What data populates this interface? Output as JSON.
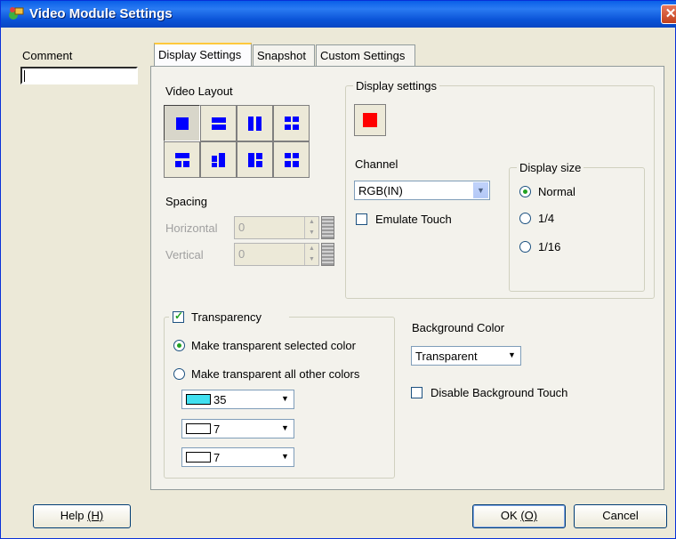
{
  "window": {
    "title": "Video Module Settings",
    "close_glyph": "✕"
  },
  "comment": {
    "label": "Comment",
    "value": ""
  },
  "tabs": [
    {
      "label": "Display Settings"
    },
    {
      "label": "Snapshot"
    },
    {
      "label": "Custom Settings"
    }
  ],
  "video_layout": {
    "label": "Video Layout",
    "buttons": [
      "layout-1-full-icon",
      "layout-2-horizontal-icon",
      "layout-2-vertical-icon",
      "layout-4-grid-icon",
      "layout-3-top-split-icon",
      "layout-3-left-split-icon",
      "layout-3-right-split-icon",
      "layout-4-quad-icon"
    ],
    "selected_index": 0
  },
  "spacing": {
    "label": "Spacing",
    "horizontal_label": "Horizontal",
    "horizontal_value": "0",
    "vertical_label": "Vertical",
    "vertical_value": "0"
  },
  "display_settings": {
    "label": "Display settings",
    "channel_label": "Channel",
    "channel_value": "RGB(IN)",
    "emulate_touch_label": "Emulate Touch",
    "emulate_touch_checked": false,
    "display_size": {
      "label": "Display size",
      "options": [
        "Normal",
        "1/4",
        "1/16"
      ],
      "selected": "Normal"
    },
    "indicator_color": "#ff0000"
  },
  "transparency": {
    "label": "Transparency",
    "checked": true,
    "option_selected": "Make transparent selected color",
    "option_other": "Make transparent all other colors",
    "colors": [
      {
        "value": "35",
        "swatch": "#40e0f0"
      },
      {
        "value": "7",
        "swatch": "#ffffff"
      },
      {
        "value": "7",
        "swatch": "#ffffff"
      }
    ]
  },
  "background": {
    "label": "Background Color",
    "value": "Transparent",
    "disable_touch_label": "Disable Background Touch",
    "disable_touch_checked": false
  },
  "buttons": {
    "help_text": "Help ",
    "help_key": "(H)",
    "ok_text": "OK ",
    "ok_key": "(O)",
    "cancel": "Cancel"
  },
  "colors": {
    "accent_blue": "#0000ff",
    "title_bar": "#0a5fe8"
  }
}
